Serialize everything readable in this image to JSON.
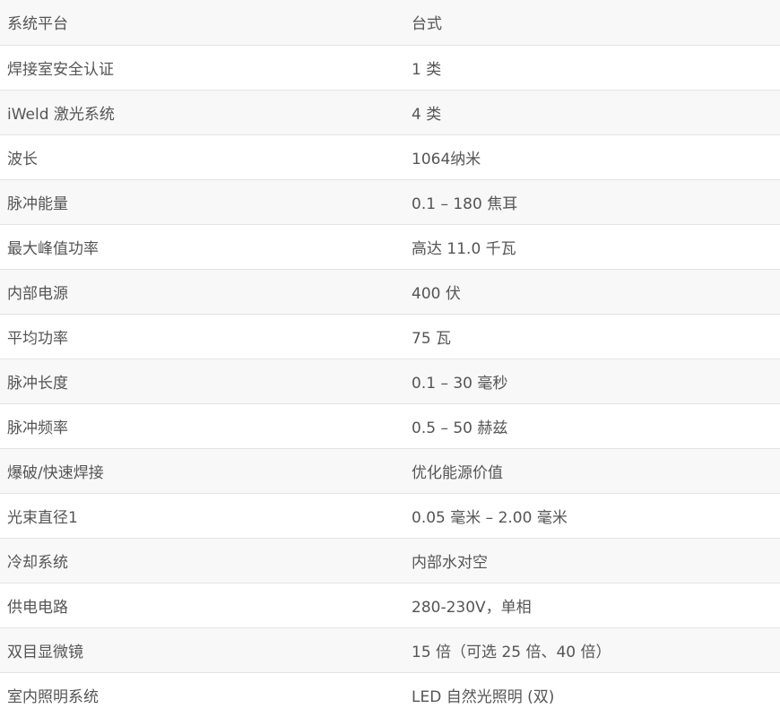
{
  "specs": {
    "rows": [
      {
        "label": "系统平台",
        "value": "台式"
      },
      {
        "label": "焊接室安全认证",
        "value": "1 类"
      },
      {
        "label": "iWeld 激光系统",
        "value": "4 类"
      },
      {
        "label": "波长",
        "value": "1064纳米"
      },
      {
        "label": "脉冲能量",
        "value": "0.1 – 180 焦耳"
      },
      {
        "label": "最大峰值功率",
        "value": "高达 11.0 千瓦"
      },
      {
        "label": "内部电源",
        "value": "400 伏"
      },
      {
        "label": "平均功率",
        "value": "75 瓦"
      },
      {
        "label": "脉冲长度",
        "value": "0.1 – 30 毫秒"
      },
      {
        "label": "脉冲频率",
        "value": "0.5 – 50 赫兹"
      },
      {
        "label": "爆破/快速焊接",
        "value": "优化能源价值"
      },
      {
        "label": "光束直径1",
        "value": "0.05 毫米 – 2.00 毫米"
      },
      {
        "label": "冷却系统",
        "value": "内部水对空"
      },
      {
        "label": "供电电路",
        "value": "280-230V，单相"
      },
      {
        "label": "双目显微镜",
        "value": "15 倍（可选 25 倍、40 倍）"
      },
      {
        "label": "室内照明系统",
        "value": "LED 自然光照明 (双)"
      }
    ]
  }
}
